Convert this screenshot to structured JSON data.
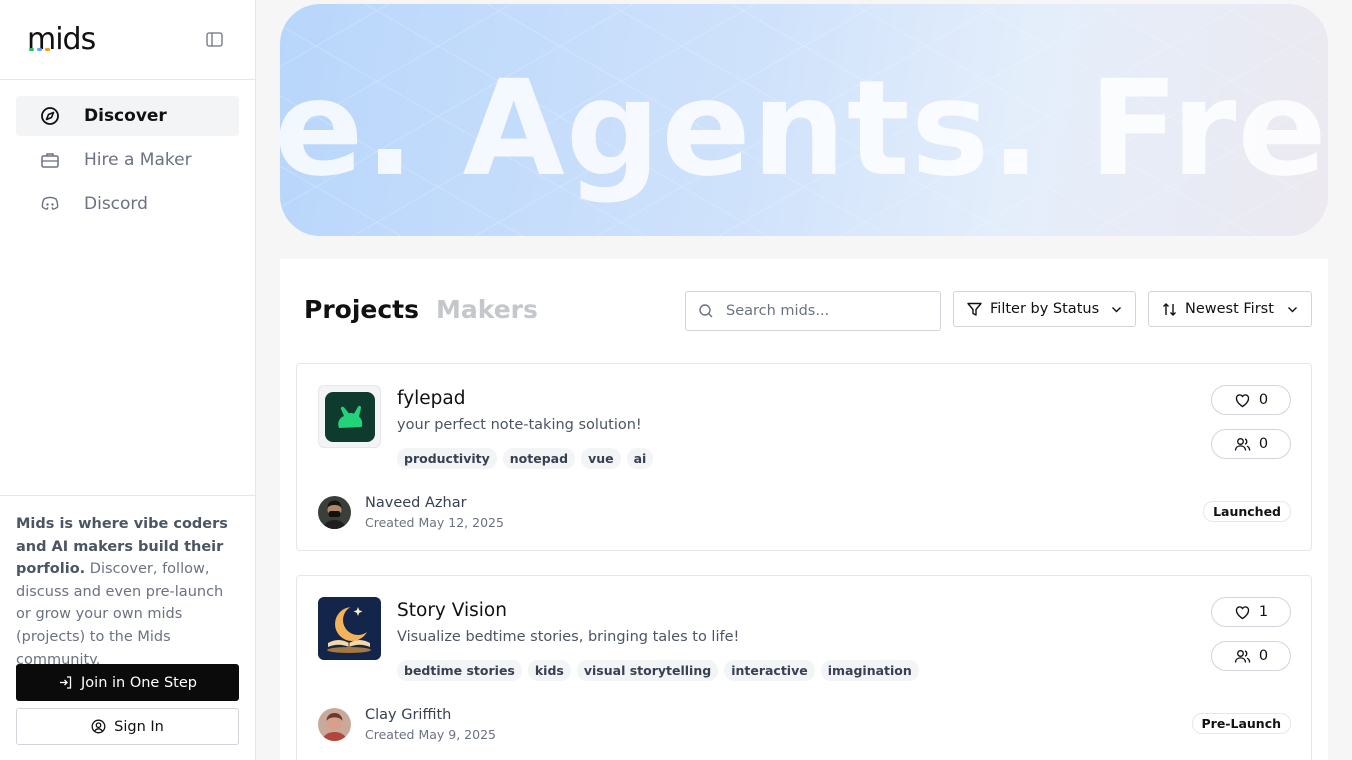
{
  "app": {
    "logo": "mids",
    "logo_dot_colors": [
      "#22c55e",
      "#60a5fa",
      "#f59e0b"
    ]
  },
  "sidebar": {
    "items": [
      {
        "label": "Discover",
        "icon": "compass-icon",
        "active": true
      },
      {
        "label": "Hire a Maker",
        "icon": "briefcase-icon",
        "active": false
      },
      {
        "label": "Discord",
        "icon": "discord-icon",
        "active": false
      }
    ],
    "about_bold": "Mids is where vibe coders and AI makers build their porfolio.",
    "about_rest": " Discover, follow, discuss and even pre-launch or grow your own mids (projects) to the Mids community.",
    "join_label": "Join in One Step",
    "signin_label": "Sign In"
  },
  "hero": {
    "text": "e. Agents. Fresh I"
  },
  "main": {
    "tabs": [
      {
        "label": "Projects",
        "active": true
      },
      {
        "label": "Makers",
        "active": false
      }
    ],
    "search": {
      "placeholder": "Search mids..."
    },
    "filter_label": "Filter by Status",
    "sort_label": "Newest First"
  },
  "projects": [
    {
      "title": "fylepad",
      "description": "your perfect note-taking solution!",
      "tags": [
        "productivity",
        "notepad",
        "vue",
        "ai"
      ],
      "likes": "0",
      "followers": "0",
      "maker": "Naveed Azhar",
      "created": "Created May 12, 2025",
      "status": "Launched"
    },
    {
      "title": "Story Vision",
      "description": "Visualize bedtime stories, bringing tales to life!",
      "tags": [
        "bedtime stories",
        "kids",
        "visual storytelling",
        "interactive",
        "imagination"
      ],
      "likes": "1",
      "followers": "0",
      "maker": "Clay Griffith",
      "created": "Created May 9, 2025",
      "status": "Pre-Launch"
    }
  ]
}
